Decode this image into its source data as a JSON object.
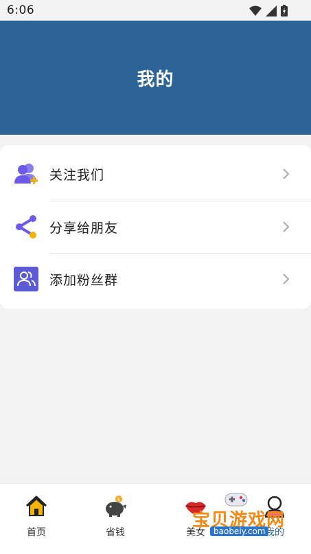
{
  "status_bar": {
    "time": "6:06"
  },
  "header": {
    "title": "我的"
  },
  "menu": {
    "items": [
      {
        "label": "关注我们",
        "icon": "follow-users-icon"
      },
      {
        "label": "分享给朋友",
        "icon": "share-icon"
      },
      {
        "label": "添加粉丝群",
        "icon": "fan-group-icon"
      }
    ]
  },
  "bottom_nav": {
    "items": [
      {
        "label": "首页",
        "icon": "home-icon"
      },
      {
        "label": "省钱",
        "icon": "piggy-bank-icon"
      },
      {
        "label": "美女",
        "icon": "lips-icon"
      },
      {
        "label": "我的",
        "icon": "profile-icon"
      }
    ]
  },
  "watermark": {
    "text": "宝贝游戏网",
    "url": "baobeiy.com"
  },
  "colors": {
    "header_bg": "#2d6497",
    "accent_purple": "#6b5be8",
    "accent_yellow": "#f5b400",
    "page_bg": "#f3f3f3"
  }
}
